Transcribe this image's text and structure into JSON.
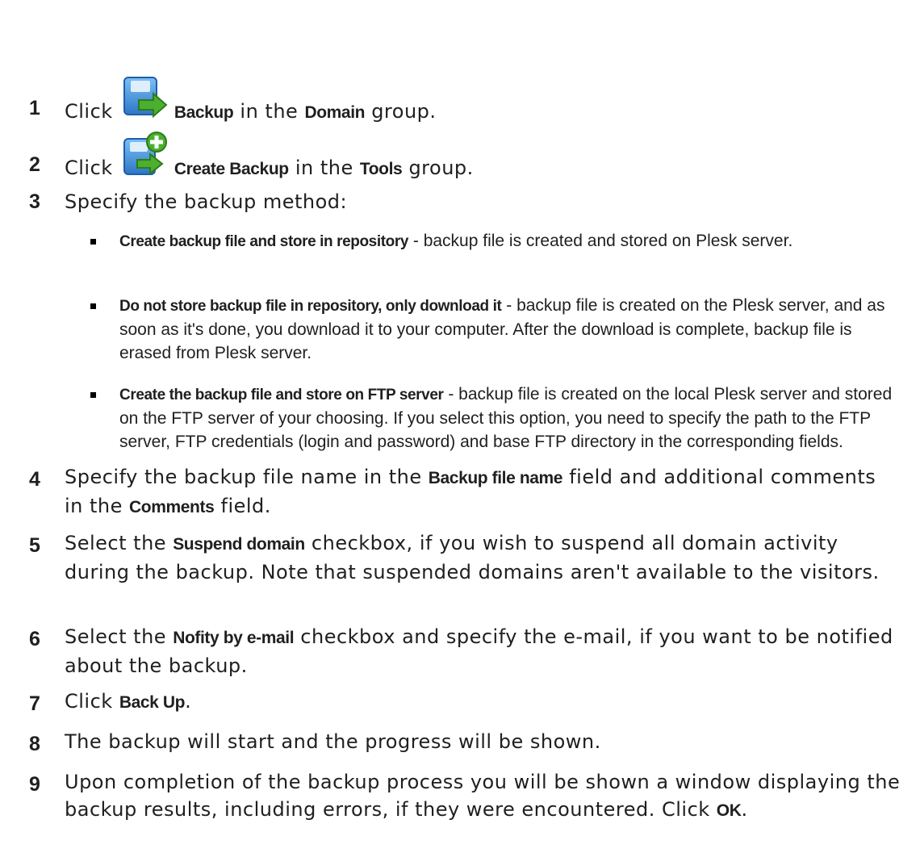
{
  "steps": [
    {
      "num": "1",
      "pre": "Click ",
      "b1": "Backup",
      "mid": " in the ",
      "b2": "Domain",
      "post": " group."
    },
    {
      "num": "2",
      "pre": "Click ",
      "b1": "Create Backup",
      "mid": " in the ",
      "b2": "Tools",
      "post": " group."
    },
    {
      "num": "3",
      "text": "Specify the backup method:"
    },
    {
      "num": "4",
      "pre": "Specify the backup file name in the ",
      "b1": "Backup file name",
      "mid": " field and additional comments in the ",
      "b2": "Comments",
      "post": " field."
    },
    {
      "num": "5",
      "pre": "Select the ",
      "b1": "Suspend domain",
      "post": " checkbox, if you wish to suspend all domain activity during the backup. Note that suspended domains aren't available to the visitors."
    },
    {
      "num": "6",
      "pre": "Select the ",
      "b1": "Nofity by e-mail",
      "post": " checkbox and specify the e-mail, if you want to be notified about the backup."
    },
    {
      "num": "7",
      "pre": "Click ",
      "b1": "Back Up",
      "post": "."
    },
    {
      "num": "8",
      "text": "The backup will start and the progress will be shown."
    },
    {
      "num": "9",
      "pre": "Upon completion of the backup process you will be shown a window displaying the backup results, including errors, if they were encountered. Click ",
      "b1": "OK",
      "post": "."
    }
  ],
  "methods": [
    {
      "title": "Create backup file and store in repository",
      "desc": " - backup file is created and stored on Plesk server."
    },
    {
      "title": "Do not store backup file in repository, only download it",
      "desc": " - backup file is created on the Plesk server, and as soon as it's done, you download it to your computer. After the download is complete, backup file is erased from Plesk server."
    },
    {
      "title": "Create the backup file and store on FTP server",
      "desc": " - backup file is created on the local Plesk server and stored on the FTP server of your choosing. If you select this option, you need to specify the path to the FTP server, FTP credentials (login and password) and base FTP directory in the corresponding fields."
    }
  ],
  "icons": {
    "step1": "backup-icon",
    "step2": "create-backup-icon",
    "colors": {
      "blue": "#3a8fd8",
      "green": "#4caf2f"
    }
  }
}
